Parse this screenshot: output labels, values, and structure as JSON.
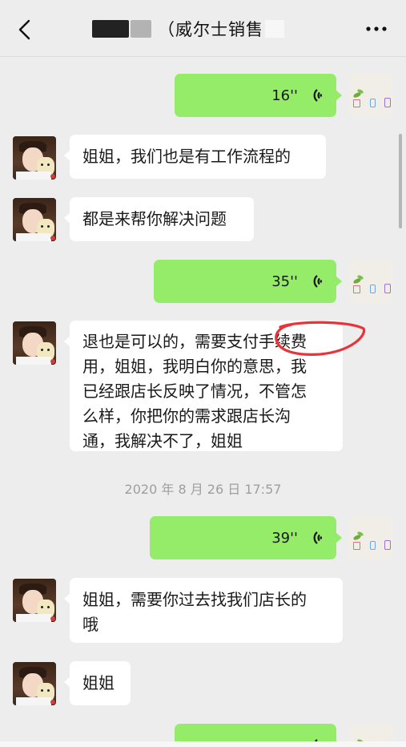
{
  "header": {
    "title": "（威尔士销售",
    "back_icon": "chevron-left-icon",
    "more_icon": "more-dots-icon"
  },
  "colors": {
    "background": "#ededed",
    "incoming_bubble": "#ffffff",
    "outgoing_bubble": "#95ec69",
    "timestamp_text": "#9e9e9e",
    "annotation_circle": "#e8333a"
  },
  "messages": [
    {
      "direction": "out",
      "type": "voice",
      "duration": "16''"
    },
    {
      "direction": "in",
      "type": "text",
      "text": "姐姐，我们也是有工作流程的"
    },
    {
      "direction": "in",
      "type": "text",
      "text": "都是来帮你解决问题"
    },
    {
      "direction": "out",
      "type": "voice",
      "duration": "35''"
    },
    {
      "direction": "in",
      "type": "text",
      "lines": [
        "退也是可以的，需要支付手续费",
        "用，姐姐，我明白你的意思，我",
        "已经跟店长反映了情况，不管怎",
        "么样，你把你的需求跟店长沟",
        "通，我解决不了，姐姐"
      ]
    },
    {
      "direction": "out",
      "type": "voice",
      "duration": "39''"
    },
    {
      "direction": "in",
      "type": "text",
      "lines": [
        "姐姐，需要你过去找我们店长的",
        "哦"
      ]
    },
    {
      "direction": "in",
      "type": "text",
      "text": "姐姐"
    },
    {
      "direction": "out",
      "type": "voice",
      "duration": ""
    }
  ],
  "timestamp": "2020 年 8 月 26 日 17:57"
}
